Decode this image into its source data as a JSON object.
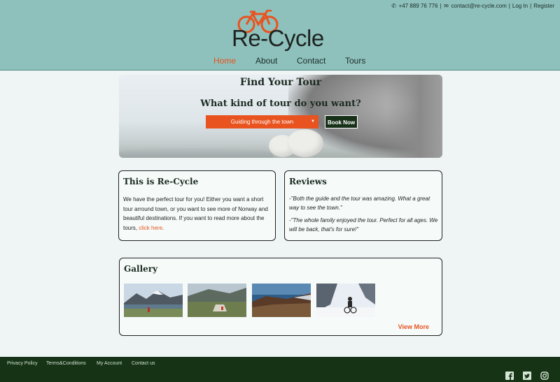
{
  "topbar": {
    "phone": "+47 889 76 776",
    "email": "contact@re-cycle.com",
    "login": "Log In",
    "register": "Register"
  },
  "brand": {
    "name": "Re-Cycle",
    "accent": "#e8531f"
  },
  "nav": {
    "items": [
      {
        "label": "Home",
        "active": true
      },
      {
        "label": "About"
      },
      {
        "label": "Contact"
      },
      {
        "label": "Tours"
      }
    ]
  },
  "hero": {
    "title": "Find Your Tour",
    "subtitle": "What kind of tour do you want?",
    "select_value": "Guiding through the town",
    "book_label": "Book Now"
  },
  "about": {
    "title": "This is Re-Cycle",
    "text": "We have the perfect tour for you! Either you want a short tour arround town, or you want to see more of Norway and beautiful destinations. If you want to read more about the tours, ",
    "link": "click here",
    "after_link": "."
  },
  "reviews": {
    "title": "Reviews",
    "items": [
      "-\"Both the guide and the tour was amazing. What a great way to see the town.\"",
      "-\"The whole family enjoyed the tour. Perfect for all ages. We will be back, that's for sure!\""
    ]
  },
  "gallery": {
    "title": "Gallery",
    "view_more": "View More"
  },
  "footer": {
    "links": [
      "Privacy Policy",
      "Terms&Conditions",
      "My Account",
      "Contact us"
    ],
    "social_icons": [
      "facebook-icon",
      "twitter-icon",
      "instagram-icon"
    ]
  },
  "colors": {
    "header_bg": "#8ec1bb",
    "page_bg": "#eef5f4",
    "footer_bg": "#163315",
    "accent": "#e8531f",
    "button_dark": "#173018"
  }
}
